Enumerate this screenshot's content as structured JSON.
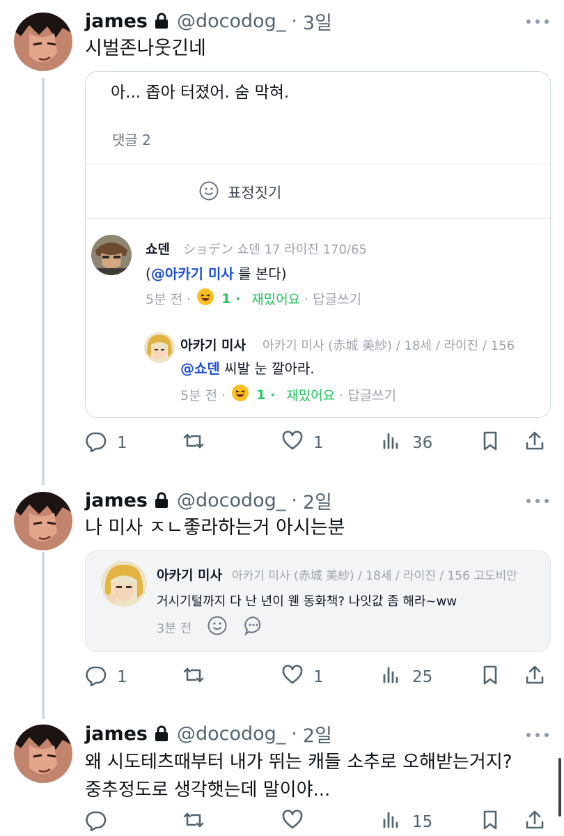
{
  "tweets": [
    {
      "name": "james",
      "handle": "@docodog_",
      "dot": "·",
      "time": "3일",
      "text": "시벌존나웃긴네",
      "card": {
        "post_text": "아... 좁아 터졌어. 숨 막혀.",
        "comment_count": "댓글 2",
        "reaction_label": "표정짓기",
        "comments": [
          {
            "author": "쇼덴",
            "meta": "ショデン 쇼덴 17 라이진 170/65",
            "mention": "@아카기 미사",
            "open_paren": "(",
            "text": " 를 본다)",
            "time": "5분 전 ·",
            "reaction_count": "1 ·",
            "reaction_label": "재밌어요",
            "reply": "· 답글쓰기"
          },
          {
            "author": "아카기 미사",
            "meta": "아카기 미사 (赤城 美紗) / 18세 / 라이진 / 156",
            "mention": "@쇼덴",
            "text": " 씨발 눈 깔아라.",
            "time": "5분 전 ·",
            "reaction_count": "1 ·",
            "reaction_label": "재밌어요",
            "reply": "· 답글쓰기"
          }
        ]
      },
      "actions": {
        "replies": "1",
        "reposts": "",
        "likes": "1",
        "views": "36"
      }
    },
    {
      "name": "james",
      "handle": "@docodog_",
      "dot": "·",
      "time": "2일",
      "text": "나 미사 ㅈㄴ좋라하는거 아시는분",
      "card": {
        "author": "아카기 미사",
        "meta": "아카기 미사 (赤城 美紗) / 18세 / 라이진 / 156 고도비만",
        "text": "거시기털까지 다 난 년이 웬 동화책? 나잇값 좀 해라~ww",
        "time": "3분 전"
      },
      "actions": {
        "replies": "1",
        "reposts": "",
        "likes": "1",
        "views": "25"
      }
    },
    {
      "name": "james",
      "handle": "@docodog_",
      "dot": "·",
      "time": "2일",
      "text_line1": "왜 시도테츠때부터 내가 뛰는 캐들 소추로 오해받는거지?",
      "text_line2": "중추정도로 생각햇는데 말이야...",
      "actions": {
        "replies": "",
        "reposts": "",
        "likes": "",
        "views": "15"
      }
    }
  ],
  "colors": {
    "text": "#0f1419",
    "secondary": "#536471",
    "mention": "#1d4ed8",
    "reaction_green": "#22c55e",
    "border": "#cfd9de"
  }
}
